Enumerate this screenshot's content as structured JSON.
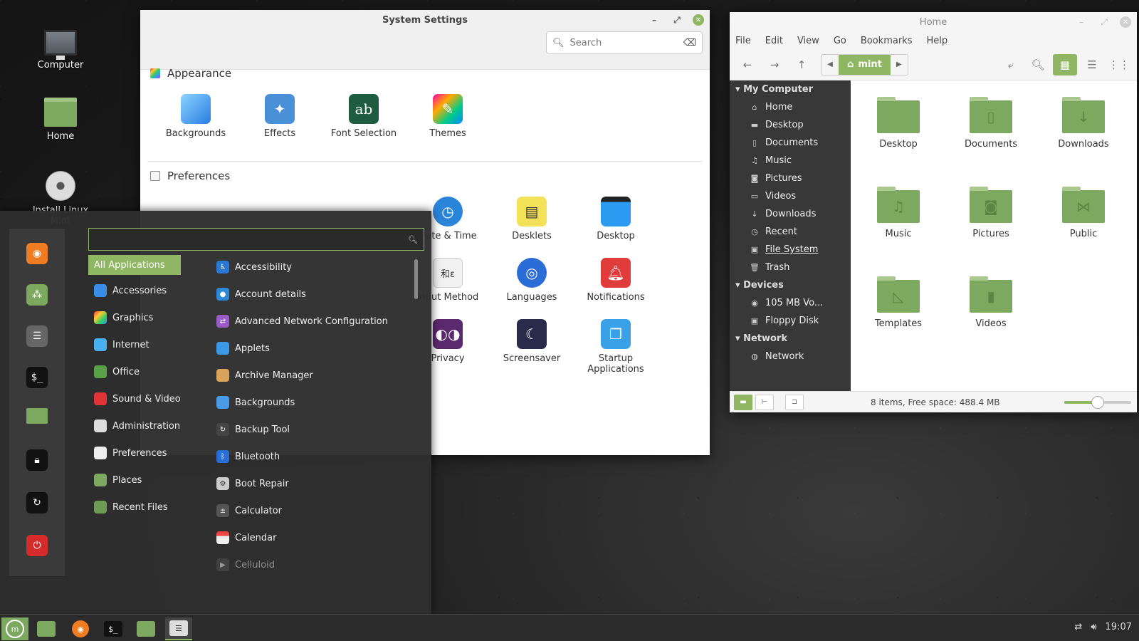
{
  "colors": {
    "accent": "#8fb662",
    "menu_bg": "#2e2e2e",
    "sidebar_bg": "#383838"
  },
  "desktop": {
    "icons": [
      {
        "label": "Computer",
        "icon": "computer-icon"
      },
      {
        "label": "Home",
        "icon": "home-folder-icon"
      },
      {
        "label": "Install Linux Mint",
        "icon": "disc-icon"
      }
    ]
  },
  "settings": {
    "title": "System Settings",
    "search_placeholder": "Search",
    "sections": [
      {
        "title": "Appearance",
        "items": [
          "Backgrounds",
          "Effects",
          "Font Selection",
          "Themes"
        ]
      },
      {
        "title": "Preferences",
        "items": [
          "Date & Time",
          "Desklets",
          "Desktop",
          "Input Method",
          "Languages",
          "Notifications",
          "Privacy",
          "Screensaver",
          "Startup Applications"
        ]
      }
    ]
  },
  "files": {
    "title": "Home",
    "menu": [
      "File",
      "Edit",
      "View",
      "Go",
      "Bookmarks",
      "Help"
    ],
    "path": "mint",
    "sidebar": {
      "my_computer": "My Computer",
      "my_computer_items": [
        "Home",
        "Desktop",
        "Documents",
        "Music",
        "Pictures",
        "Videos",
        "Downloads",
        "Recent",
        "File System",
        "Trash"
      ],
      "devices": "Devices",
      "devices_items": [
        "105 MB Vo...",
        "Floppy Disk"
      ],
      "network": "Network",
      "network_items": [
        "Network"
      ]
    },
    "items": [
      "Desktop",
      "Documents",
      "Downloads",
      "Music",
      "Pictures",
      "Public",
      "Templates",
      "Videos"
    ],
    "status": "8 items, Free space: 488.4 MB",
    "zoom": 0.5
  },
  "menu": {
    "search_value": "",
    "categories": [
      "All Applications",
      "Accessories",
      "Graphics",
      "Internet",
      "Office",
      "Sound & Video",
      "Administration",
      "Preferences",
      "Places",
      "Recent Files"
    ],
    "apps": [
      "Accessibility",
      "Account details",
      "Advanced Network Configuration",
      "Applets",
      "Archive Manager",
      "Backgrounds",
      "Backup Tool",
      "Bluetooth",
      "Boot Repair",
      "Calculator",
      "Calendar",
      "Celluloid"
    ]
  },
  "taskbar": {
    "clock": "19:07"
  }
}
